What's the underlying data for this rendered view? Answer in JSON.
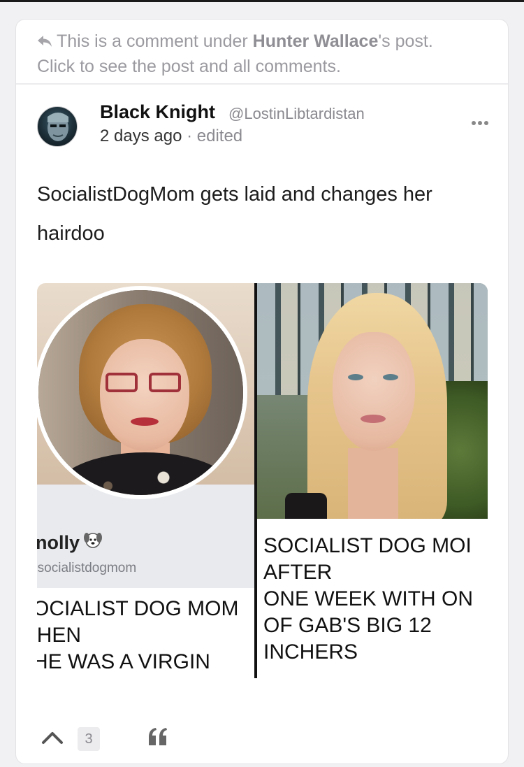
{
  "comment_context": {
    "prefix": "This is a comment under ",
    "author": "Hunter Wallace",
    "suffix": "'s post.",
    "line2": "Click to see the post and all comments."
  },
  "post": {
    "display_name": "Black Knight",
    "username": "@LostinLibtardistan",
    "timestamp": "2 days ago",
    "separator": " · ",
    "edited": "edited",
    "text": "SocialistDogMom gets laid and changes her hairdoo"
  },
  "media": {
    "left_profile_name": "nolly",
    "left_profile_handle": "⁾socialistdogmom",
    "left_caption": "OCIALIST DOG MOM\n'HEN\nHE WAS A VIRGIN",
    "right_caption": "SOCIALIST DOG MOI\nAFTER\nONE WEEK WITH ON\nOF GAB'S BIG 12\nINCHERS"
  },
  "actions": {
    "upvote_icon": "chevron-up-icon",
    "score": "3",
    "quote_icon": "quote-icon"
  },
  "colors": {
    "background": "#f1f1f3",
    "card": "#ffffff",
    "muted_text": "#9a9aa0",
    "divider": "#111111"
  }
}
